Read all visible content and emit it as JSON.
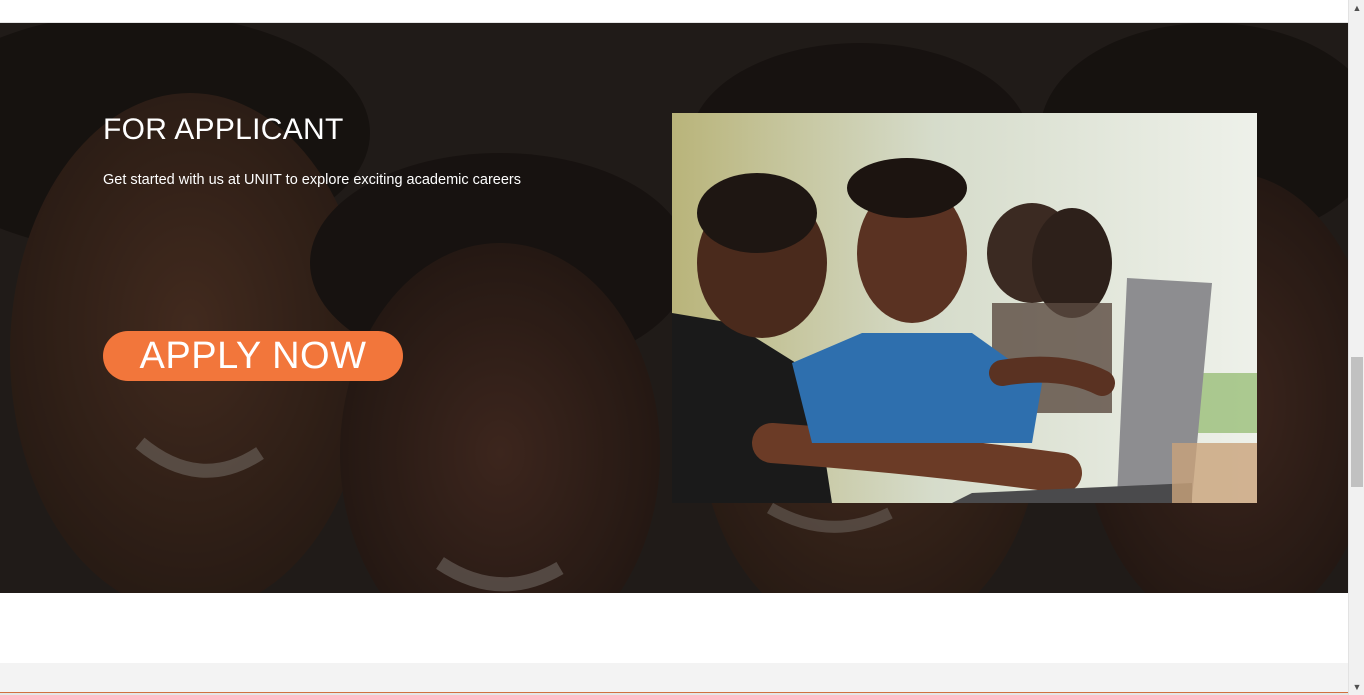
{
  "hero": {
    "title": "FOR APPLICANT",
    "subtitle": "Get started with us at UNIIT to explore exciting academic careers",
    "apply_button_label": "APPLY NOW"
  },
  "colors": {
    "accent": "#f2763b",
    "hero_overlay": "#14100e",
    "text_on_dark": "#ffffff"
  },
  "images": {
    "background": "students-smiling-background",
    "feature": "students-at-laptop-photo"
  },
  "scrollbar": {
    "up_arrow": "▲",
    "down_arrow": "▼"
  }
}
